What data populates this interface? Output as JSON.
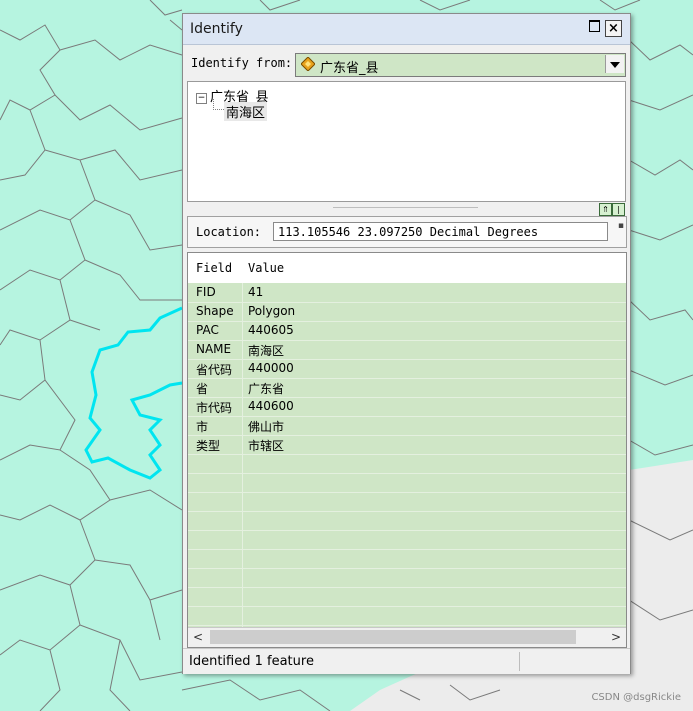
{
  "window": {
    "title": "Identify"
  },
  "identify_from": {
    "label": "Identify from:",
    "value": "广东省_县"
  },
  "tree": {
    "layer": "广东省_县",
    "feature": "南海区"
  },
  "location": {
    "label": "Location:",
    "value": "113.105546  23.097250 Decimal Degrees"
  },
  "table": {
    "headers": {
      "field": "Field",
      "value": "Value"
    },
    "rows": [
      {
        "field": "FID",
        "value": "41"
      },
      {
        "field": "Shape",
        "value": "Polygon"
      },
      {
        "field": "PAC",
        "value": "440605"
      },
      {
        "field": "NAME",
        "value": "南海区"
      },
      {
        "field": "省代码",
        "value": "440000"
      },
      {
        "field": "省",
        "value": "广东省"
      },
      {
        "field": "市代码",
        "value": "440600"
      },
      {
        "field": "市",
        "value": "佛山市"
      },
      {
        "field": "类型",
        "value": "市辖区"
      }
    ]
  },
  "status": {
    "text": "Identified 1 feature"
  },
  "watermark": "CSDN @dsgRickie",
  "colors": {
    "map_fill": "#b6f4e0",
    "selection": "#00e5f0",
    "grid_row": "#cfe6c6"
  }
}
